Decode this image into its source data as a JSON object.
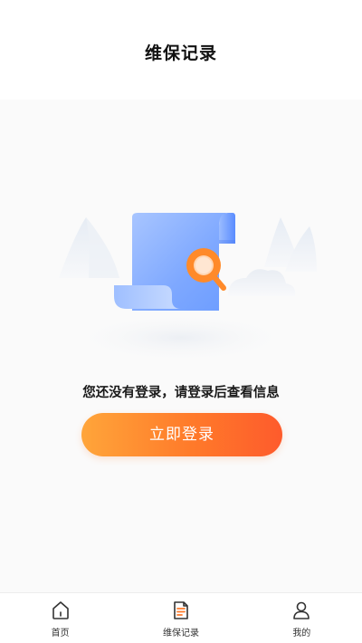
{
  "header": {
    "title": "维保记录"
  },
  "empty_state": {
    "illustration": "document-search-illustration",
    "message": "您还没有登录，请登录后查看信息",
    "button_label": "立即登录"
  },
  "tabbar": {
    "items": [
      {
        "label": "首页",
        "icon": "home-icon"
      },
      {
        "label": "维保记录",
        "icon": "document-list-icon"
      },
      {
        "label": "我的",
        "icon": "user-icon"
      }
    ]
  },
  "colors": {
    "accent_start": "#ffa53a",
    "accent_end": "#fe5b2c",
    "document_blue": "#6d9dff",
    "search_orange": "#ff8a2a"
  }
}
